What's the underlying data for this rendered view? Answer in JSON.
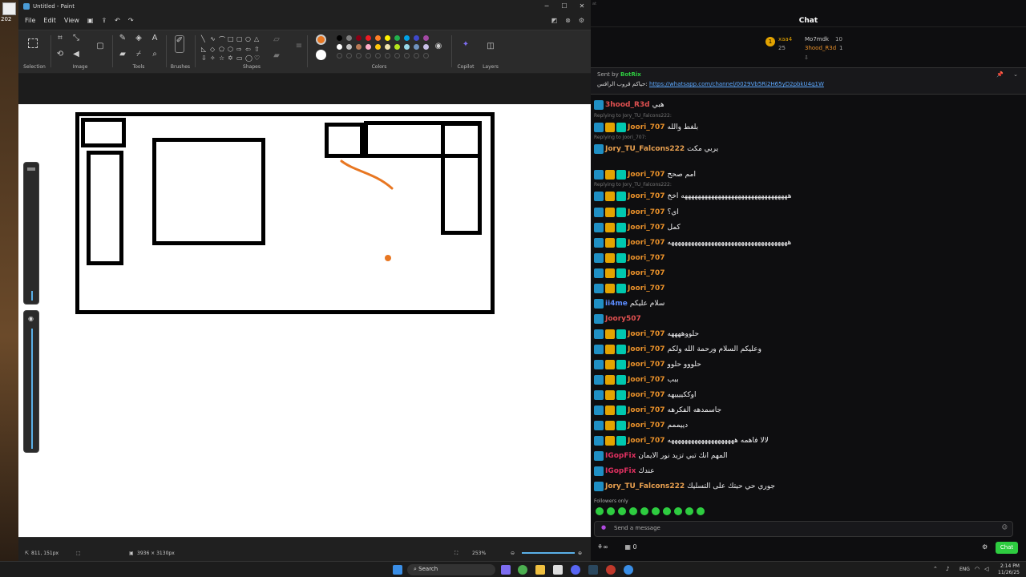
{
  "desktop": {
    "icon_label": "202"
  },
  "paint": {
    "title": "Untitled - Paint",
    "menu": [
      "File",
      "Edit",
      "View"
    ],
    "groups": {
      "selection": "Selection",
      "image": "Image",
      "tools": "Tools",
      "brushes": "Brushes",
      "shapes": "Shapes",
      "colors": "Colors",
      "copilot": "Copilot",
      "layers": "Layers"
    },
    "status": {
      "cursor": "811, 151px",
      "canvas_size": "3936 × 3130px",
      "zoom": "253%"
    },
    "colors": {
      "primary": "#e87722",
      "secondary": "#ffffff"
    }
  },
  "chat": {
    "header": "Chat",
    "leaderboard": [
      {
        "rank": "1",
        "name": "xaa4",
        "count": "25"
      },
      {
        "rank": "",
        "name": "Mo7mdk",
        "count": "10"
      },
      {
        "rank": "",
        "name": "3hood_R3d",
        "count": "1"
      }
    ],
    "pinned": {
      "sent_by": "Sent by",
      "bot": "BotRix",
      "text": "حياكم قروب الراقس:",
      "link": "https://whatsapp.com/channel/0029Vb5Ri2H65yD2pbkU4q1W"
    },
    "messages": [
      {
        "name": "3hood_R3d",
        "color": "#e05050",
        "text": "هبي"
      },
      {
        "reply": "Replying to Jory_TU_Falcons222:",
        "name": "Joori_707",
        "color": "#e8902a",
        "text": "بلغط والله"
      },
      {
        "reply": "Replying to Joori_707:",
        "name": "Jory_TU_Falcons222",
        "color": "#e8a050",
        "text": "يربي مكت"
      },
      {
        "name": "Joori_707",
        "color": "#e8902a",
        "text": "امم صحح"
      },
      {
        "reply": "Replying to Jory_TU_Falcons222:",
        "name": "Joori_707",
        "color": "#e8902a",
        "text": "ههههههههههههههههههههههههههههههههه اخخ"
      },
      {
        "name": "Joori_707",
        "color": "#e8902a",
        "text": "اي؟"
      },
      {
        "name": "Joori_707",
        "color": "#e8902a",
        "text": "كمل"
      },
      {
        "name": "Joori_707",
        "color": "#e8902a",
        "text": "ههههههههههههههههههههههههههههههههههههه"
      },
      {
        "name": "Joori_707",
        "color": "#e8902a",
        "text": ""
      },
      {
        "name": "Joori_707",
        "color": "#e8902a",
        "text": ""
      },
      {
        "name": "Joori_707",
        "color": "#e8902a",
        "text": ""
      },
      {
        "name": "ii4me",
        "color": "#5b8cff",
        "text": "سلام عليكم"
      },
      {
        "name": "Joory507",
        "color": "#e05050",
        "text": ""
      },
      {
        "name": "Joori_707",
        "color": "#e8902a",
        "text": "حلووههههه"
      },
      {
        "name": "Joori_707",
        "color": "#e8902a",
        "text": "وعليكم السلام ورحمة الله ولكم"
      },
      {
        "name": "Joori_707",
        "color": "#e8902a",
        "text": "حلووو حلوو"
      },
      {
        "name": "Joori_707",
        "color": "#e8902a",
        "text": "ببب"
      },
      {
        "name": "Joori_707",
        "color": "#e8902a",
        "text": "اوككييييهه"
      },
      {
        "name": "Joori_707",
        "color": "#e8902a",
        "text": "جاسمدهه الفكرهه"
      },
      {
        "name": "Joori_707",
        "color": "#e8902a",
        "text": "دييممم"
      },
      {
        "name": "Joori_707",
        "color": "#e8902a",
        "text": "لالا فاهمه ههههههههههههههههههههه"
      },
      {
        "name": "IGopFix",
        "color": "#e03060",
        "text": "المهم انك تبي تزيد نور الايمان"
      },
      {
        "name": "IGopFix",
        "color": "#e03060",
        "text": "عندك"
      },
      {
        "name": "Jory_TU_Falcons222",
        "color": "#e8a050",
        "text": "جوري حي حيتك على التسليك"
      }
    ],
    "followers_only": "Followers only",
    "send_placeholder": "Send a message",
    "chat_button": "Chat",
    "points": "0"
  },
  "taskbar": {
    "search": "Search",
    "lang": "ENG",
    "time": "2:14 PM",
    "date": "11/26/25"
  }
}
